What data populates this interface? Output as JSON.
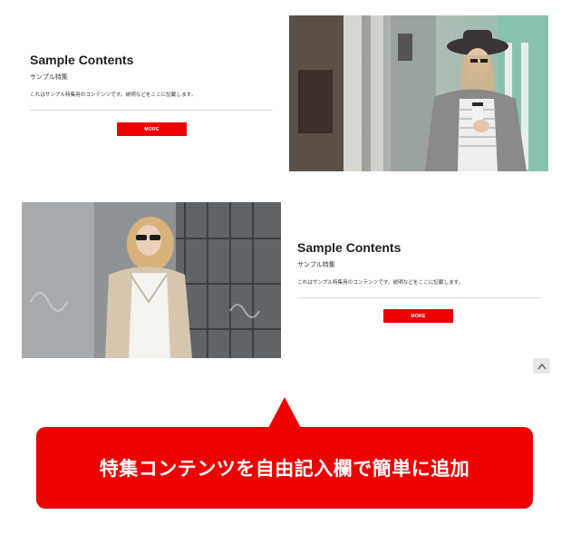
{
  "section1": {
    "title": "Sample Contents",
    "subtitle": "サンプル特集",
    "description": "これはサンプル特集用のコンテンツです。説明などをここに記載します。",
    "more_label": "MORE",
    "image": "woman-in-gray-coat-with-hat-and-coffee-photo"
  },
  "section2": {
    "title": "Sample Contents",
    "subtitle": "サンプル特集",
    "description": "これはサンプル特集用のコンテンツです。説明などをここに記載します。",
    "more_label": "MORE",
    "image": "woman-in-beige-trench-coat-with-sunglasses-photo"
  },
  "scroll_top_icon": "chevron-up-icon",
  "callout": {
    "text": "特集コンテンツを自由記入欄で簡単に追加",
    "color": "#ee0000"
  },
  "colors": {
    "accent": "#ee0000",
    "text": "#222222",
    "divider": "#dcdcdc"
  }
}
